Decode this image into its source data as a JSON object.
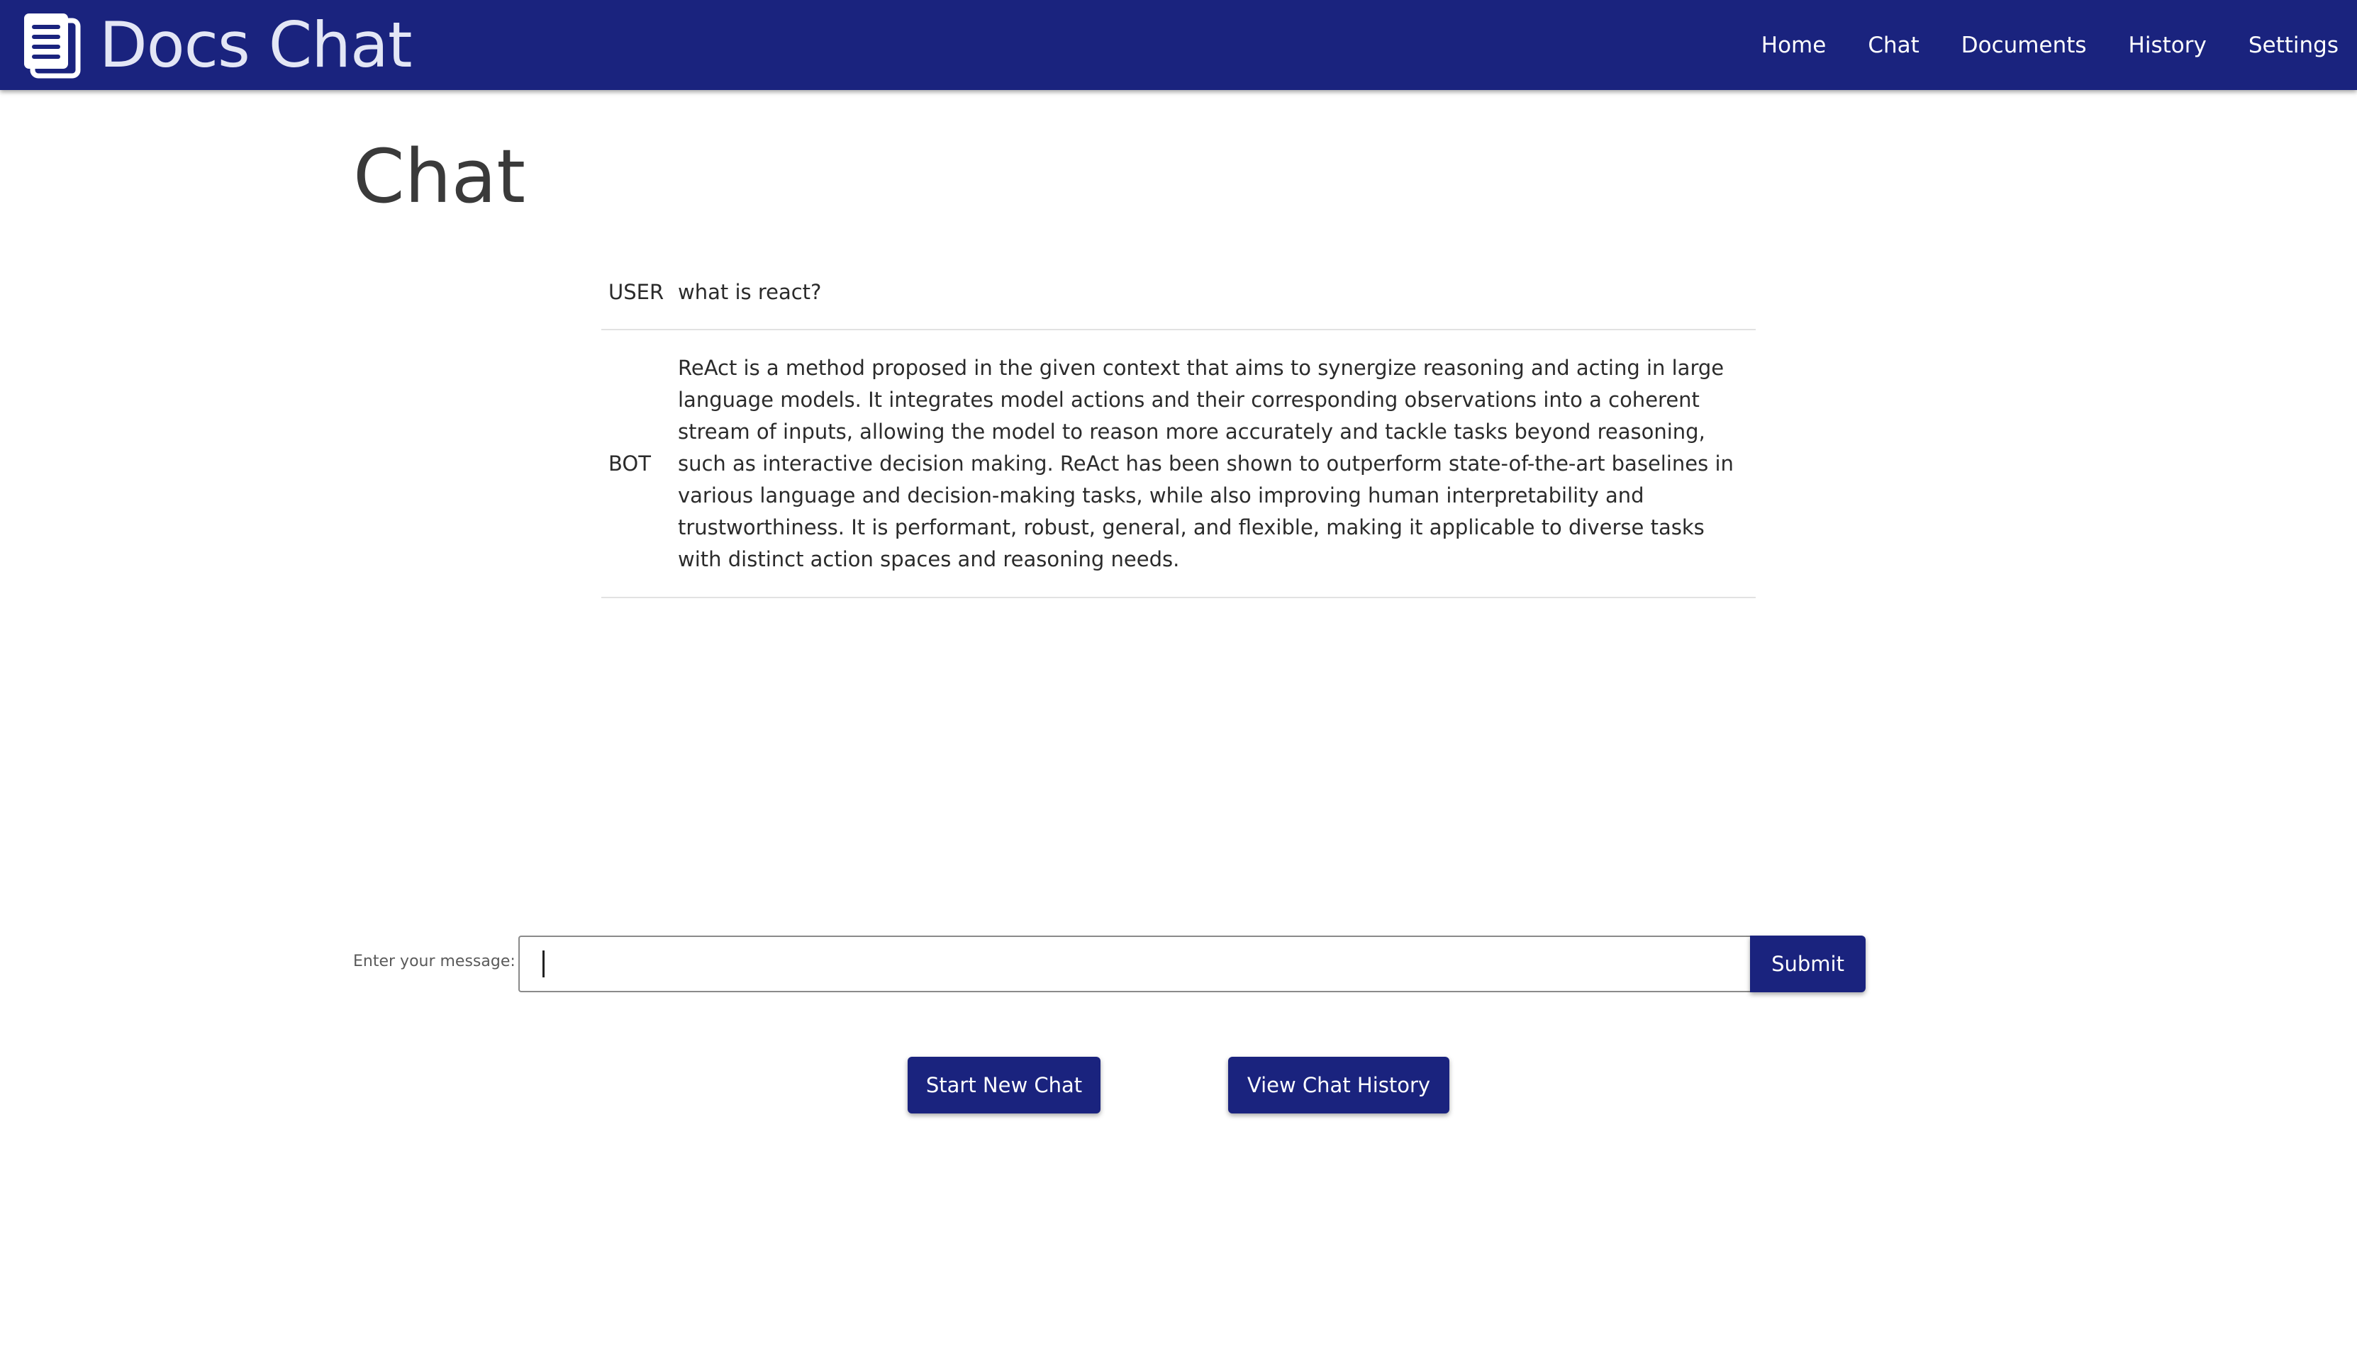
{
  "app": {
    "title": "Docs Chat",
    "brand_icon": "document-icon"
  },
  "nav": {
    "items": [
      {
        "label": "Home"
      },
      {
        "label": "Chat"
      },
      {
        "label": "Documents"
      },
      {
        "label": "History"
      },
      {
        "label": "Settings"
      }
    ]
  },
  "page": {
    "title": "Chat"
  },
  "messages": [
    {
      "role": "USER",
      "text": "what is react?"
    },
    {
      "role": "BOT",
      "text": "ReAct is a method proposed in the given context that aims to synergize reasoning and acting in large language models. It integrates model actions and their corresponding observations into a coherent stream of inputs, allowing the model to reason more accurately and tackle tasks beyond reasoning, such as interactive decision making. ReAct has been shown to outperform state-of-the-art baselines in various language and decision-making tasks, while also improving human interpretability and trustworthiness. It is performant, robust, general, and flexible, making it applicable to diverse tasks with distinct action spaces and reasoning needs."
    }
  ],
  "composer": {
    "label": "Enter your message:",
    "value": "",
    "submit_label": "Submit"
  },
  "actions": {
    "new_chat_label": "Start New Chat",
    "history_label": "View Chat History"
  },
  "colors": {
    "primary": "#1a237e",
    "brand_text": "#e3e6f5",
    "background": "#ffffff",
    "divider": "#e2e2e2"
  }
}
